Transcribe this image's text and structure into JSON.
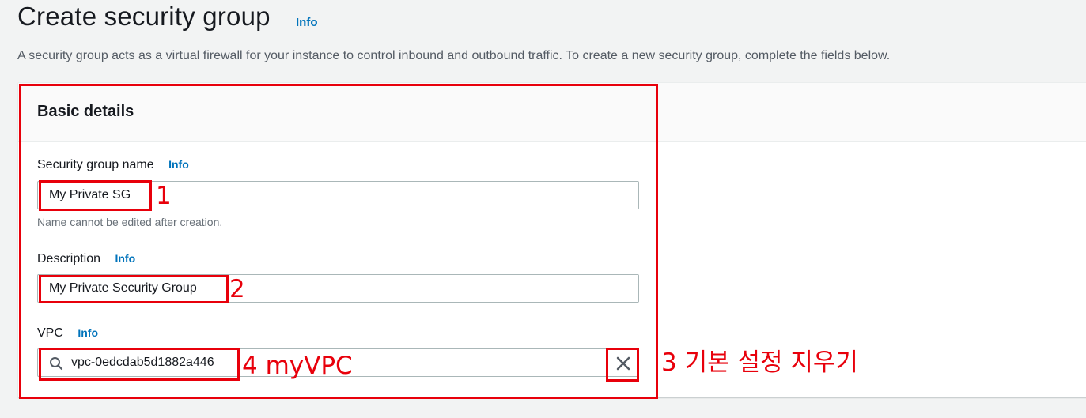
{
  "header": {
    "title": "Create security group",
    "title_info": "Info",
    "description": "A security group acts as a virtual firewall for your instance to control inbound and outbound traffic. To create a new security group, complete the fields below."
  },
  "basic_details": {
    "title": "Basic details",
    "name_field": {
      "label": "Security group name",
      "info": "Info",
      "value": "My Private SG",
      "hint": "Name cannot be edited after creation."
    },
    "description_field": {
      "label": "Description",
      "info": "Info",
      "value": "My Private Security Group"
    },
    "vpc_field": {
      "label": "VPC",
      "info": "Info",
      "value": "vpc-0edcdab5d1882a446",
      "search_icon": "search-icon",
      "clear_icon": "close-icon"
    }
  },
  "annotations": {
    "step1": "1",
    "step2": "2",
    "step3": "3 기본 설정 지우기",
    "step4": "4 myVPC",
    "color": "#e8000b"
  },
  "colors": {
    "info_link": "#0073bb",
    "background": "#f2f3f3",
    "input_border": "#aab7b8"
  }
}
